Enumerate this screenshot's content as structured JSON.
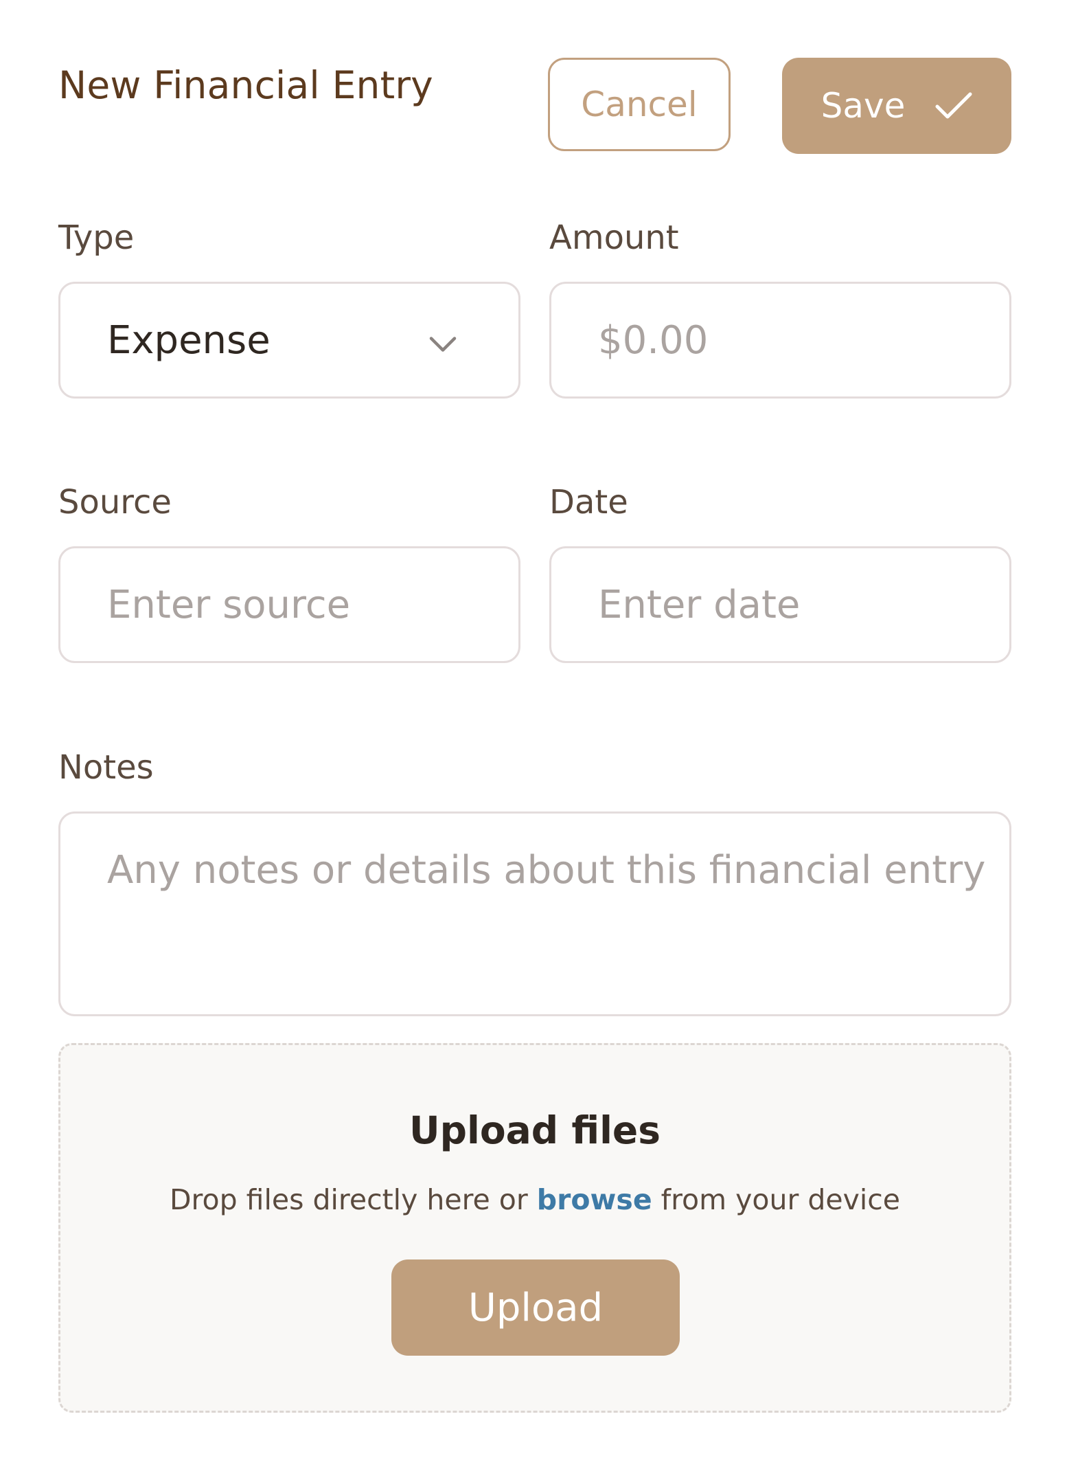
{
  "header": {
    "title": "New Financial Entry",
    "cancel_label": "Cancel",
    "save_label": "Save",
    "save_icon": "check-icon"
  },
  "form": {
    "type": {
      "label": "Type",
      "selected": "Expense",
      "icon": "chevron-down-icon"
    },
    "amount": {
      "label": "Amount",
      "placeholder": "$0.00"
    },
    "source": {
      "label": "Source",
      "placeholder": "Enter source"
    },
    "date": {
      "label": "Date",
      "placeholder": "Enter date"
    },
    "notes": {
      "label": "Notes",
      "placeholder": "Any notes or details about this financial entry"
    }
  },
  "upload": {
    "title": "Upload files",
    "desc_before": "Drop files directly here or",
    "browse_link": "browse",
    "desc_after": "from your device",
    "button_label": "Upload"
  },
  "colors": {
    "accent": "#c09f7d",
    "title": "#5c3a1e",
    "link": "#3e7aa6",
    "border": "#e4dcdc",
    "placeholder": "#aaa3a0"
  }
}
